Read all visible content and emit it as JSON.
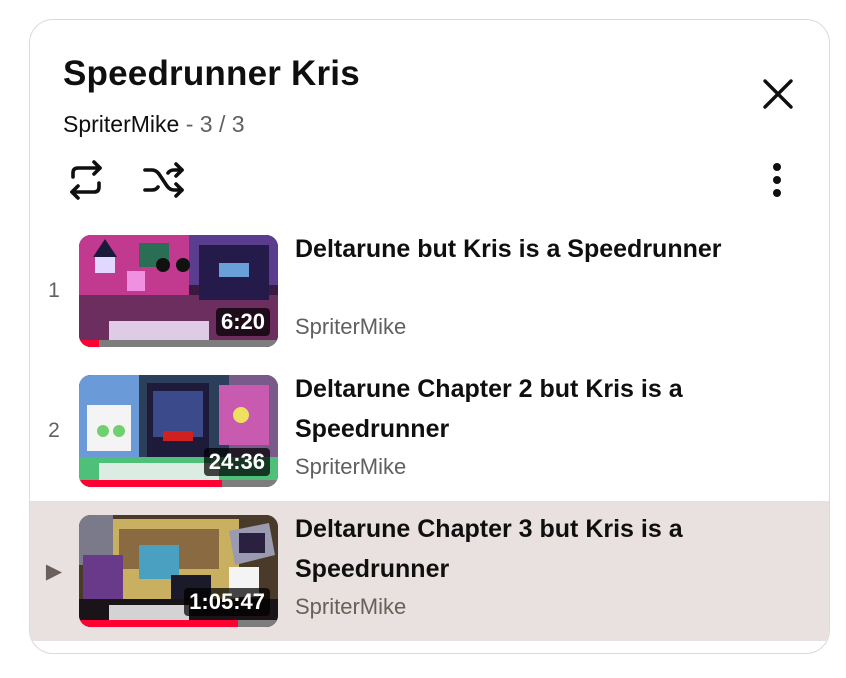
{
  "playlist": {
    "title": "Speedrunner Kris",
    "channel": "SpriterMike",
    "separator": " - ",
    "position": "3 / 3"
  },
  "controls": {
    "close_icon": "close-icon",
    "loop_icon": "loop-icon",
    "shuffle_icon": "shuffle-icon",
    "more_icon": "more-vert-icon"
  },
  "videos": [
    {
      "index": "1",
      "title": "Deltarune but Kris is a Speedrunner",
      "channel": "SpriterMike",
      "duration": "6:20",
      "watched_fraction": 0.1,
      "active": false
    },
    {
      "index": "2",
      "title": "Deltarune Chapter 2 but Kris is a Speedrunner",
      "channel": "SpriterMike",
      "duration": "24:36",
      "watched_fraction": 0.72,
      "active": false
    },
    {
      "index": "▶",
      "title": "Deltarune Chapter 3 but Kris is a Speedrunner",
      "channel": "SpriterMike",
      "duration": "1:05:47",
      "watched_fraction": 0.8,
      "active": true
    }
  ],
  "colors": {
    "accent": "#ff0033",
    "active_row": "#e9e1df",
    "text_secondary": "#606060"
  }
}
